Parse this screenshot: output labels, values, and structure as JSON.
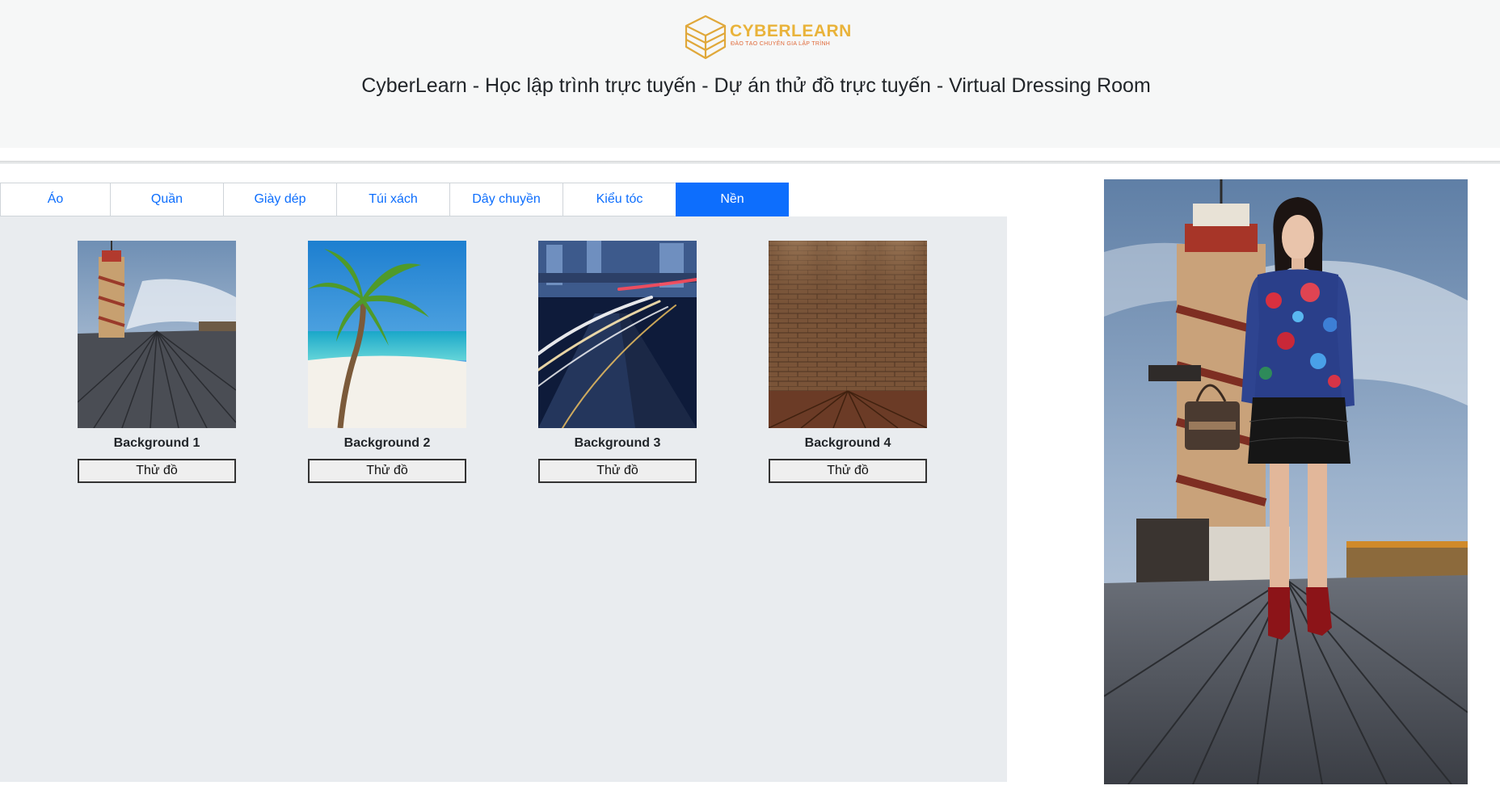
{
  "header": {
    "logo_name": "CYBERLEARN",
    "logo_tagline": "ĐÀO TẠO CHUYÊN GIA LẬP TRÌNH",
    "title": "CyberLearn - Học lập trình trực tuyến - Dự án thử đồ trực tuyến - Virtual Dressing Room"
  },
  "tabs": [
    {
      "label": "Áo",
      "active": false
    },
    {
      "label": "Quần",
      "active": false
    },
    {
      "label": "Giày dép",
      "active": false
    },
    {
      "label": "Túi xách",
      "active": false
    },
    {
      "label": "Dây chuyền",
      "active": false
    },
    {
      "label": "Kiểu tóc",
      "active": false
    },
    {
      "label": "Nền",
      "active": true
    }
  ],
  "items": [
    {
      "name": "Background 1",
      "button": "Thử đồ",
      "scene": "pier-tower"
    },
    {
      "name": "Background 2",
      "button": "Thử đồ",
      "scene": "palm-beach"
    },
    {
      "name": "Background 3",
      "button": "Thử đồ",
      "scene": "city-road-light-trails"
    },
    {
      "name": "Background 4",
      "button": "Thử đồ",
      "scene": "brick-wall-spotlights"
    }
  ],
  "preview": {
    "scene": "pier-tower",
    "model": "woman in floral sweater, black lace skirt, red boots, handbag"
  },
  "colors": {
    "accent": "#0d6efd",
    "header_bg": "#f6f7f7",
    "panel_bg": "#e9ecef",
    "logo_gold": "#e9b33a"
  }
}
